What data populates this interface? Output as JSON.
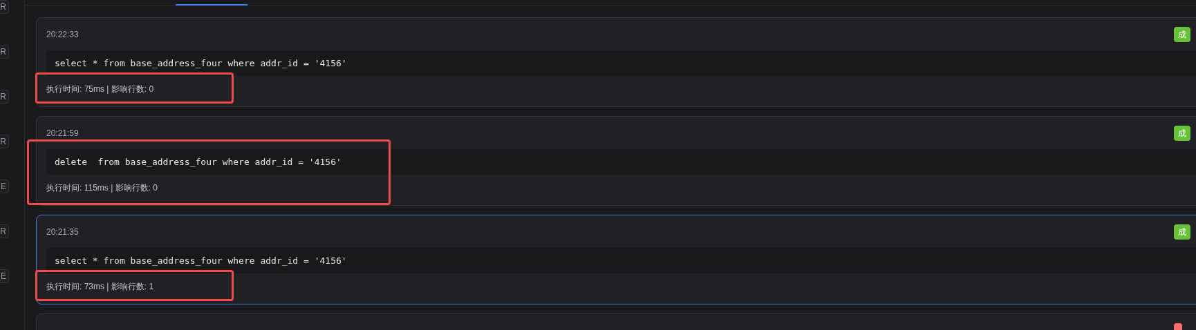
{
  "sidebar_tags": [
    {
      "text": "R"
    },
    {
      "text": "R"
    },
    {
      "text": "R"
    },
    {
      "text": "R"
    },
    {
      "text": "E"
    },
    {
      "text": "R"
    },
    {
      "text": "E"
    }
  ],
  "tabs": [
    {
      "selected": true
    }
  ],
  "history": [
    {
      "time": "20:22:33",
      "sql": "select * from base_address_four where addr_id = '4156'",
      "stats": "执行时间: 75ms | 影响行数: 0",
      "color": "#67c23a",
      "badge": "成",
      "selected": false,
      "highlight": {
        "kind": "stats"
      }
    },
    {
      "time": "20:21:59",
      "sql": "delete  from base_address_four where addr_id = '4156'",
      "stats": "执行时间: 115ms | 影响行数: 0",
      "color": "#67c23a",
      "badge": "成",
      "selected": false,
      "highlight": {
        "kind": "query"
      }
    },
    {
      "time": "20:21:35",
      "sql": "select * from base_address_four where addr_id = '4156'",
      "stats": "执行时间: 73ms | 影响行数: 1",
      "color": "#67c23a",
      "badge": "成",
      "selected": true,
      "highlight": {
        "kind": "stats"
      }
    },
    {
      "color": "#f56c6c",
      "selected": false
    }
  ]
}
